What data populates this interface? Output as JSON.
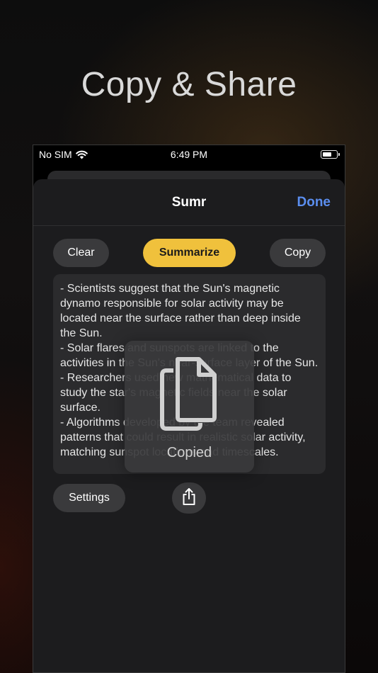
{
  "hero": {
    "title": "Copy & Share"
  },
  "status_bar": {
    "carrier": "No SIM",
    "time": "6:49 PM"
  },
  "nav": {
    "title": "Sumr",
    "done_label": "Done"
  },
  "toolbar": {
    "clear_label": "Clear",
    "summarize_label": "Summarize",
    "copy_label": "Copy"
  },
  "summary_text": "- Scientists suggest that the Sun's magnetic dynamo responsible for solar activity may be located near the surface rather than deep inside the Sun.\n- Solar flares and sunspots are linked to the activities in the Sun's near-surface layer of the Sun.\n- Researchers used new mathematical data to study the star's magnetic fields near the solar surface.\n- Algorithms developed by the team revealed patterns that could result in realistic solar activity, matching sunspot locations and timescales.",
  "bottom": {
    "settings_label": "Settings"
  },
  "toast": {
    "label": "Copied"
  },
  "colors": {
    "accent_blue": "#5b8ef0",
    "summarize_yellow": "#f0c13c",
    "sheet_bg": "#1c1c1e"
  }
}
